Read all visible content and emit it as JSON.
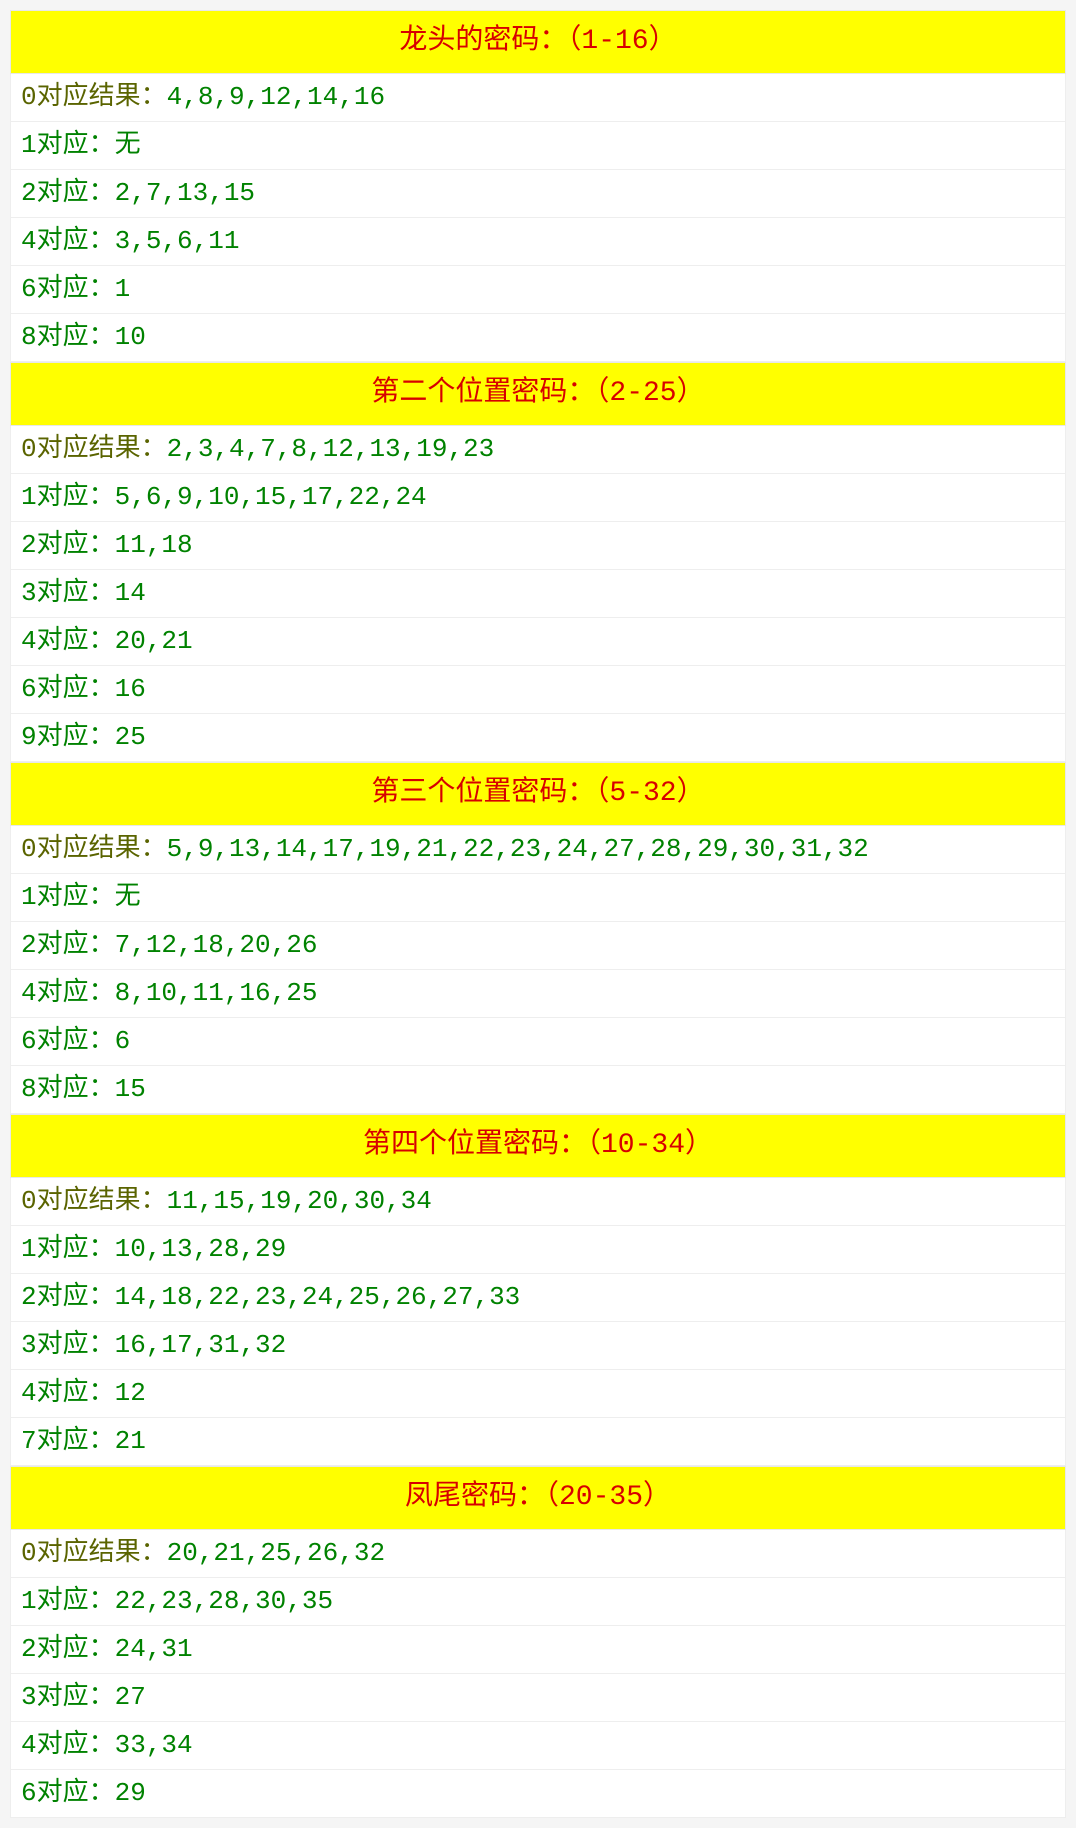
{
  "sections": [
    {
      "title": "龙头的密码：（1-16）",
      "rows": [
        {
          "key": "0对应结果：",
          "val": "4,8,9,12,14,16"
        },
        {
          "key": "1对应：",
          "val": "无"
        },
        {
          "key": "2对应：",
          "val": "2,7,13,15"
        },
        {
          "key": "4对应：",
          "val": "3,5,6,11"
        },
        {
          "key": "6对应：",
          "val": "1"
        },
        {
          "key": "8对应：",
          "val": "10"
        }
      ]
    },
    {
      "title": "第二个位置密码：（2-25）",
      "rows": [
        {
          "key": "0对应结果：",
          "val": "2,3,4,7,8,12,13,19,23"
        },
        {
          "key": "1对应：",
          "val": "5,6,9,10,15,17,22,24"
        },
        {
          "key": "2对应：",
          "val": "11,18"
        },
        {
          "key": "3对应：",
          "val": "14"
        },
        {
          "key": "4对应：",
          "val": "20,21"
        },
        {
          "key": "6对应：",
          "val": "16"
        },
        {
          "key": "9对应：",
          "val": "25"
        }
      ]
    },
    {
      "title": "第三个位置密码：（5-32）",
      "rows": [
        {
          "key": "0对应结果：",
          "val": "5,9,13,14,17,19,21,22,23,24,27,28,29,30,31,32"
        },
        {
          "key": "1对应：",
          "val": "无"
        },
        {
          "key": "2对应：",
          "val": "7,12,18,20,26"
        },
        {
          "key": "4对应：",
          "val": "8,10,11,16,25"
        },
        {
          "key": "6对应：",
          "val": "6"
        },
        {
          "key": "8对应：",
          "val": "15"
        }
      ]
    },
    {
      "title": "第四个位置密码：（10-34）",
      "rows": [
        {
          "key": "0对应结果：",
          "val": "11,15,19,20,30,34"
        },
        {
          "key": "1对应：",
          "val": "10,13,28,29"
        },
        {
          "key": "2对应：",
          "val": "14,18,22,23,24,25,26,27,33"
        },
        {
          "key": "3对应：",
          "val": "16,17,31,32"
        },
        {
          "key": "4对应：",
          "val": "12"
        },
        {
          "key": "7对应：",
          "val": "21"
        }
      ]
    },
    {
      "title": "凤尾密码：（20-35）",
      "rows": [
        {
          "key": "0对应结果：",
          "val": "20,21,25,26,32"
        },
        {
          "key": "1对应：",
          "val": "22,23,28,30,35"
        },
        {
          "key": "2对应：",
          "val": "24,31"
        },
        {
          "key": "3对应：",
          "val": "27"
        },
        {
          "key": "4对应：",
          "val": "33,34"
        },
        {
          "key": "6对应：",
          "val": "29"
        }
      ]
    }
  ]
}
